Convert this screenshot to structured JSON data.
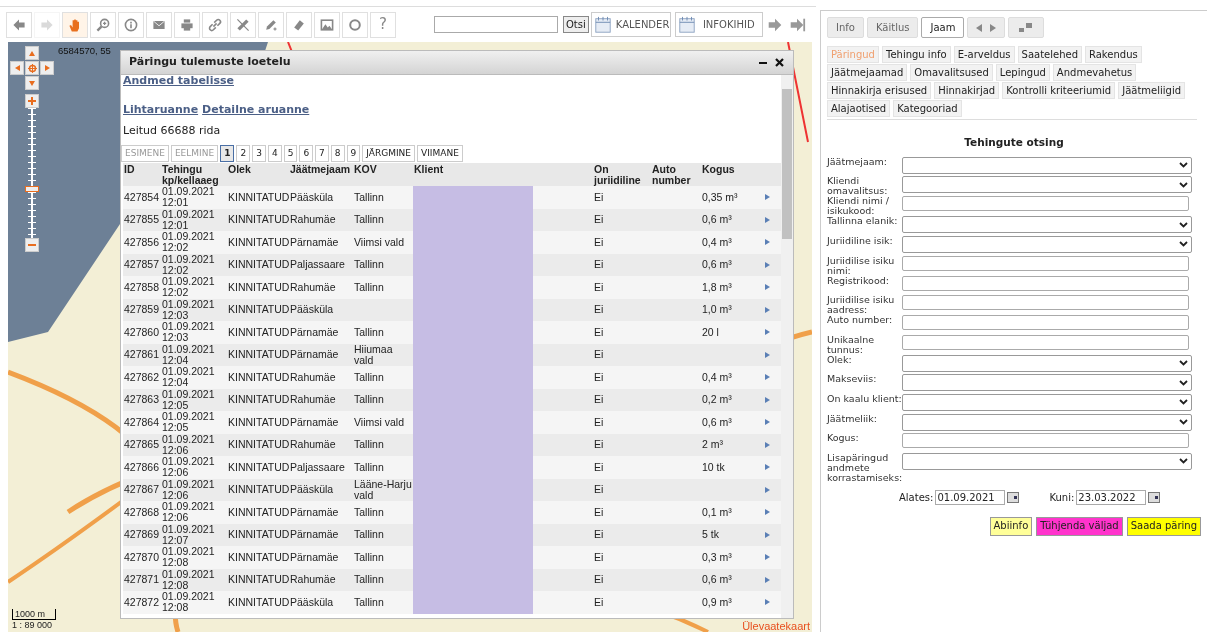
{
  "toolbar": {
    "tools": [
      {
        "selected": false,
        "disabled": false
      },
      {
        "selected": false,
        "disabled": true
      },
      {
        "selected": true,
        "disabled": false
      },
      {
        "selected": false,
        "disabled": false
      },
      {
        "selected": false,
        "disabled": false
      },
      {
        "selected": false,
        "disabled": false
      },
      {
        "selected": false,
        "disabled": false
      },
      {
        "selected": false,
        "disabled": false
      },
      {
        "selected": false,
        "disabled": false
      },
      {
        "selected": false,
        "disabled": false
      },
      {
        "selected": false,
        "disabled": false
      },
      {
        "selected": false,
        "disabled": false
      },
      {
        "selected": false,
        "disabled": false
      }
    ],
    "help": "?",
    "search_button": "Otsi",
    "calendar": "KALENDER",
    "layers": "INFOKIHID"
  },
  "map": {
    "zoom_slider": {
      "level": 0.37
    },
    "coordinates": "6584570, 55",
    "scale": "1000 m",
    "ratio": "1 : 89 000",
    "overview": "Ülevaatekaart"
  },
  "dialog": {
    "title": "Päringu tulemuste loetelu",
    "table_link": "Andmed tabelisse",
    "reports": [
      "Lihtaruanne",
      "Detailne aruanne"
    ],
    "found": "Leitud 66688 rida",
    "pager": [
      {
        "label": "ESIMENE",
        "selected": false,
        "disabled": true
      },
      {
        "label": "EELMINE",
        "selected": false,
        "disabled": true
      },
      {
        "label": "1",
        "selected": true,
        "disabled": false
      },
      {
        "label": "2",
        "selected": false,
        "disabled": false
      },
      {
        "label": "3",
        "selected": false,
        "disabled": false
      },
      {
        "label": "4",
        "selected": false,
        "disabled": false
      },
      {
        "label": "5",
        "selected": false,
        "disabled": false
      },
      {
        "label": "6",
        "selected": false,
        "disabled": false
      },
      {
        "label": "7",
        "selected": false,
        "disabled": false
      },
      {
        "label": "8",
        "selected": false,
        "disabled": false
      },
      {
        "label": "9",
        "selected": false,
        "disabled": false
      },
      {
        "label": "JÄRGMINE",
        "selected": false,
        "disabled": false
      },
      {
        "label": "VIIMANE",
        "selected": false,
        "disabled": false
      }
    ],
    "columns": [
      "ID",
      "Tehingu kp/kellaaeg",
      "Olek",
      "Jäätmejaam",
      "KOV",
      "Klient",
      "On juriidiline",
      "Auto number",
      "Kogus"
    ],
    "rows": [
      [
        "427854",
        "01.09.2021 12:01",
        "KINNITATUD",
        "Pääsküla",
        "Tallinn",
        "",
        "Ei",
        "",
        "0,35 m³"
      ],
      [
        "427855",
        "01.09.2021 12:01",
        "KINNITATUD",
        "Rahumäe",
        "Tallinn",
        "",
        "Ei",
        "",
        "0,6 m³"
      ],
      [
        "427856",
        "01.09.2021 12:02",
        "KINNITATUD",
        "Pärnamäe",
        "Viimsi vald",
        "",
        "Ei",
        "",
        "0,4 m³"
      ],
      [
        "427857",
        "01.09.2021 12:02",
        "KINNITATUD",
        "Paljassaare",
        "Tallinn",
        "",
        "Ei",
        "",
        "0,6 m³"
      ],
      [
        "427858",
        "01.09.2021 12:02",
        "KINNITATUD",
        "Rahumäe",
        "Tallinn",
        "",
        "Ei",
        "",
        "1,8 m³"
      ],
      [
        "427859",
        "01.09.2021 12:03",
        "KINNITATUD",
        "Pääsküla",
        "",
        "",
        "Ei",
        "",
        "1,0 m³"
      ],
      [
        "427860",
        "01.09.2021 12:03",
        "KINNITATUD",
        "Pärnamäe",
        "Tallinn",
        "",
        "Ei",
        "",
        "20 l"
      ],
      [
        "427861",
        "01.09.2021 12:04",
        "KINNITATUD",
        "Pärnamäe",
        "Hiiumaa vald",
        "",
        "Ei",
        "",
        ""
      ],
      [
        "427862",
        "01.09.2021 12:04",
        "KINNITATUD",
        "Rahumäe",
        "Tallinn",
        "",
        "Ei",
        "",
        "0,4 m³"
      ],
      [
        "427863",
        "01.09.2021 12:05",
        "KINNITATUD",
        "Rahumäe",
        "Tallinn",
        "",
        "Ei",
        "",
        "0,2 m³"
      ],
      [
        "427864",
        "01.09.2021 12:05",
        "KINNITATUD",
        "Pärnamäe",
        "Viimsi vald",
        "",
        "Ei",
        "",
        "0,6 m³"
      ],
      [
        "427865",
        "01.09.2021 12:06",
        "KINNITATUD",
        "Rahumäe",
        "Tallinn",
        "",
        "Ei",
        "",
        "2 m³"
      ],
      [
        "427866",
        "01.09.2021 12:06",
        "KINNITATUD",
        "Paljassaare",
        "Tallinn",
        "",
        "Ei",
        "",
        "10 tk"
      ],
      [
        "427867",
        "01.09.2021 12:06",
        "KINNITATUD",
        "Pääsküla",
        "Lääne-Harju vald",
        "",
        "Ei",
        "",
        ""
      ],
      [
        "427868",
        "01.09.2021 12:06",
        "KINNITATUD",
        "Pärnamäe",
        "Tallinn",
        "",
        "Ei",
        "",
        "0,1 m³"
      ],
      [
        "427869",
        "01.09.2021 12:07",
        "KINNITATUD",
        "Pärnamäe",
        "Tallinn",
        "",
        "Ei",
        "",
        "5 tk"
      ],
      [
        "427870",
        "01.09.2021 12:08",
        "KINNITATUD",
        "Pärnamäe",
        "Tallinn",
        "",
        "Ei",
        "",
        "0,3 m³"
      ],
      [
        "427871",
        "01.09.2021 12:08",
        "KINNITATUD",
        "Rahumäe",
        "Tallinn",
        "",
        "Ei",
        "",
        "0,6 m³"
      ],
      [
        "427872",
        "01.09.2021 12:08",
        "KINNITATUD",
        "Pääsküla",
        "Tallinn",
        "",
        "Ei",
        "",
        "0,9 m³"
      ]
    ]
  },
  "panel": {
    "tabs": [
      {
        "label": "Info",
        "selected": false
      },
      {
        "label": "Käitlus",
        "selected": false
      },
      {
        "label": "Jaam",
        "selected": true
      }
    ],
    "subtabs": [
      {
        "label": "Päringud",
        "selected": true
      },
      {
        "label": "Tehingu info",
        "selected": false
      },
      {
        "label": "E-arveldus",
        "selected": false
      },
      {
        "label": "Saatelehed",
        "selected": false
      },
      {
        "label": "Rakendus",
        "selected": false
      },
      {
        "label": "Jäätmejaamad",
        "selected": false
      },
      {
        "label": "Omavalitsused",
        "selected": false
      },
      {
        "label": "Lepingud",
        "selected": false
      },
      {
        "label": "Andmevahetus",
        "selected": false
      },
      {
        "label": "Hinnakirja erisused",
        "selected": false
      },
      {
        "label": "Hinnakirjad",
        "selected": false
      },
      {
        "label": "Kontrolli kriteeriumid",
        "selected": false
      },
      {
        "label": "Jäätmeliigid",
        "selected": false
      },
      {
        "label": "Alajaotised",
        "selected": false
      },
      {
        "label": "Kategooriad",
        "selected": false
      }
    ],
    "form_title": "Tehingute otsing",
    "fields": [
      {
        "label": "Jäätmejaam:",
        "kind": "select"
      },
      {
        "label": "Kliendi omavalitsus:",
        "kind": "select"
      },
      {
        "label": "Kliendi nimi / isikukood:",
        "kind": "text"
      },
      {
        "label": "Tallinna elanik:",
        "kind": "select"
      },
      {
        "label": "Juriidiline isik:",
        "kind": "select"
      },
      {
        "label": "Juriidilise isiku nimi:",
        "kind": "text"
      },
      {
        "label": "Registrikood:",
        "kind": "text"
      },
      {
        "label": "Juriidilise isiku aadress:",
        "kind": "text"
      },
      {
        "label": "Auto number:",
        "kind": "text"
      },
      {
        "label": "Unikaalne tunnus:",
        "kind": "text"
      },
      {
        "label": "Olek:",
        "kind": "select"
      },
      {
        "label": "Makseviis:",
        "kind": "select"
      },
      {
        "label": "On kaalu klient:",
        "kind": "select"
      },
      {
        "label": "Jäätmeliik:",
        "kind": "select"
      },
      {
        "label": "Kogus:",
        "kind": "text"
      },
      {
        "label": "Lisapäringud andmete korrastamiseks:",
        "kind": "select"
      }
    ],
    "dates": [
      {
        "label": "Alates:",
        "value": "01.09.2021"
      },
      {
        "label": "Kuni:",
        "value": "23.03.2022"
      }
    ],
    "buttons": [
      {
        "label": "Abiinfo",
        "color": "#ffff99"
      },
      {
        "label": "Tühjenda väljad",
        "color": "#ff33cc"
      },
      {
        "label": "Saada päring",
        "color": "#ffff00"
      }
    ]
  }
}
